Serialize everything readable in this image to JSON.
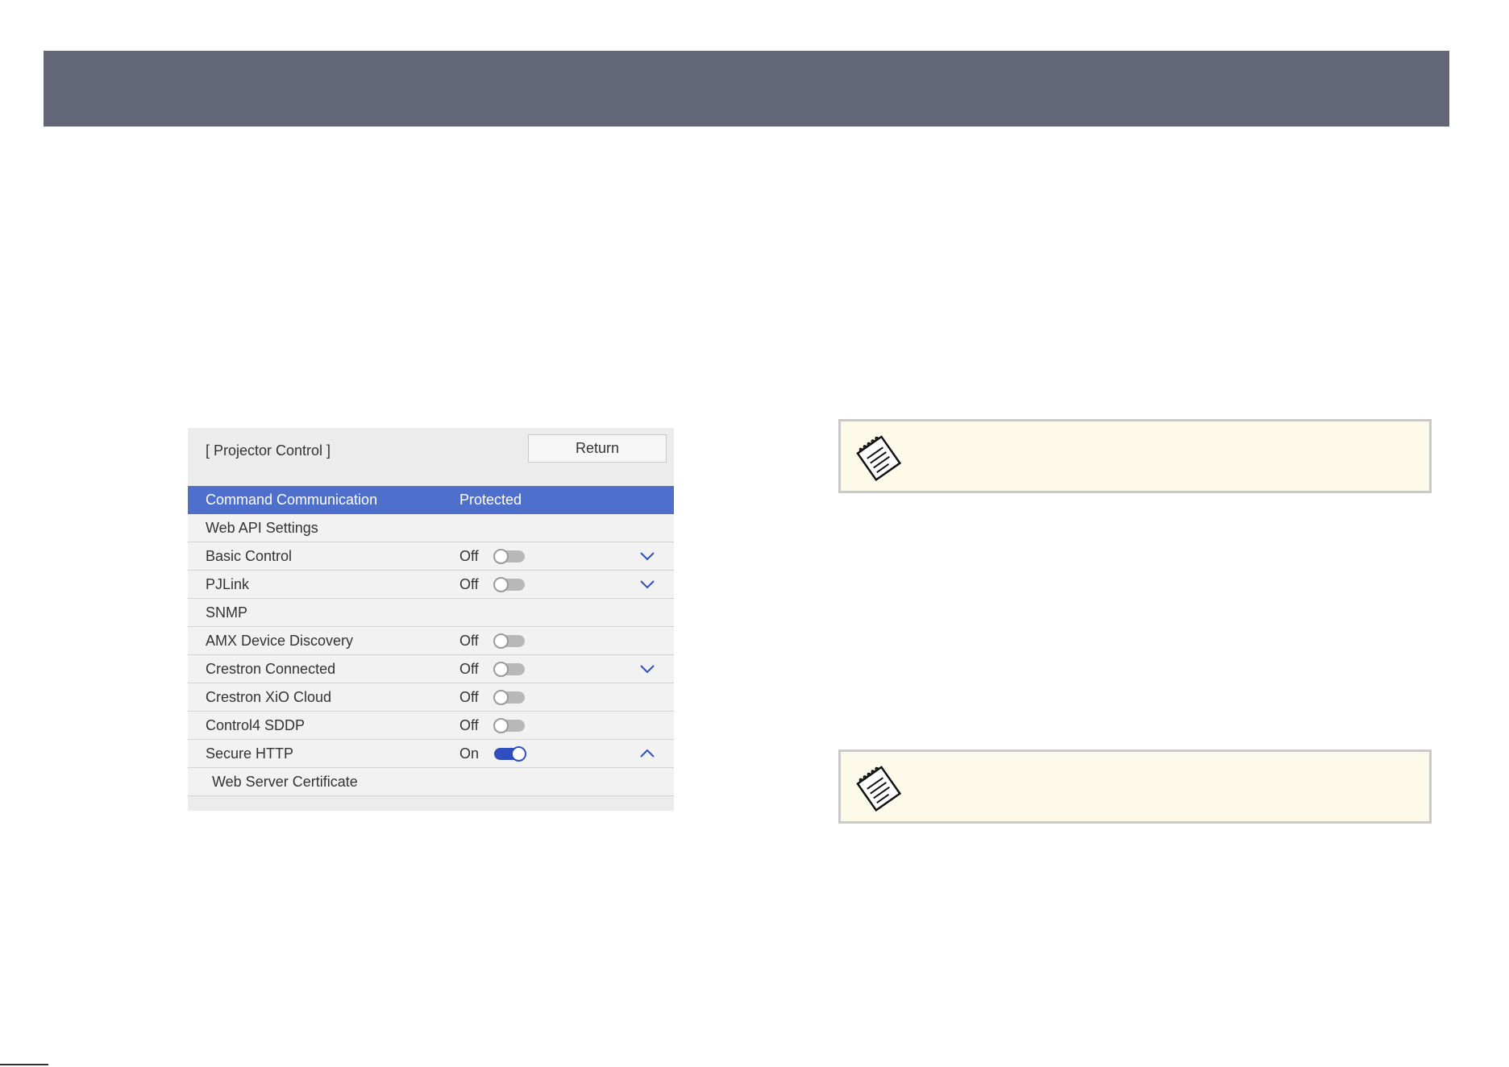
{
  "panel": {
    "title": "[ Projector Control ]",
    "return_label": "Return",
    "rows": [
      {
        "label": "Command Communication",
        "value": "Protected",
        "selected": true
      },
      {
        "label": "Web API Settings",
        "value": ""
      },
      {
        "label": "Basic Control",
        "value": "Off",
        "toggle": "off",
        "chevron": "down"
      },
      {
        "label": "PJLink",
        "value": "Off",
        "toggle": "off",
        "chevron": "down"
      },
      {
        "label": "SNMP",
        "value": ""
      },
      {
        "label": "AMX Device Discovery",
        "value": "Off",
        "toggle": "off"
      },
      {
        "label": "Crestron Connected",
        "value": "Off",
        "toggle": "off",
        "chevron": "down"
      },
      {
        "label": "Crestron XiO Cloud",
        "value": "Off",
        "toggle": "off"
      },
      {
        "label": "Control4 SDDP",
        "value": "Off",
        "toggle": "off"
      },
      {
        "label": "Secure HTTP",
        "value": "On",
        "toggle": "on",
        "chevron": "up"
      },
      {
        "label": "Web Server Certificate",
        "value": "",
        "sub": true
      }
    ]
  },
  "icons": {
    "note": "notepad-icon",
    "toggle": "toggle-switch",
    "chevron_down": "chevron-down-icon",
    "chevron_up": "chevron-up-icon"
  },
  "colors": {
    "header_bar": "#636676",
    "selected_row": "#4f6fcc",
    "toggle_on": "#2f4fbf",
    "note_background": "#fdfaea"
  }
}
